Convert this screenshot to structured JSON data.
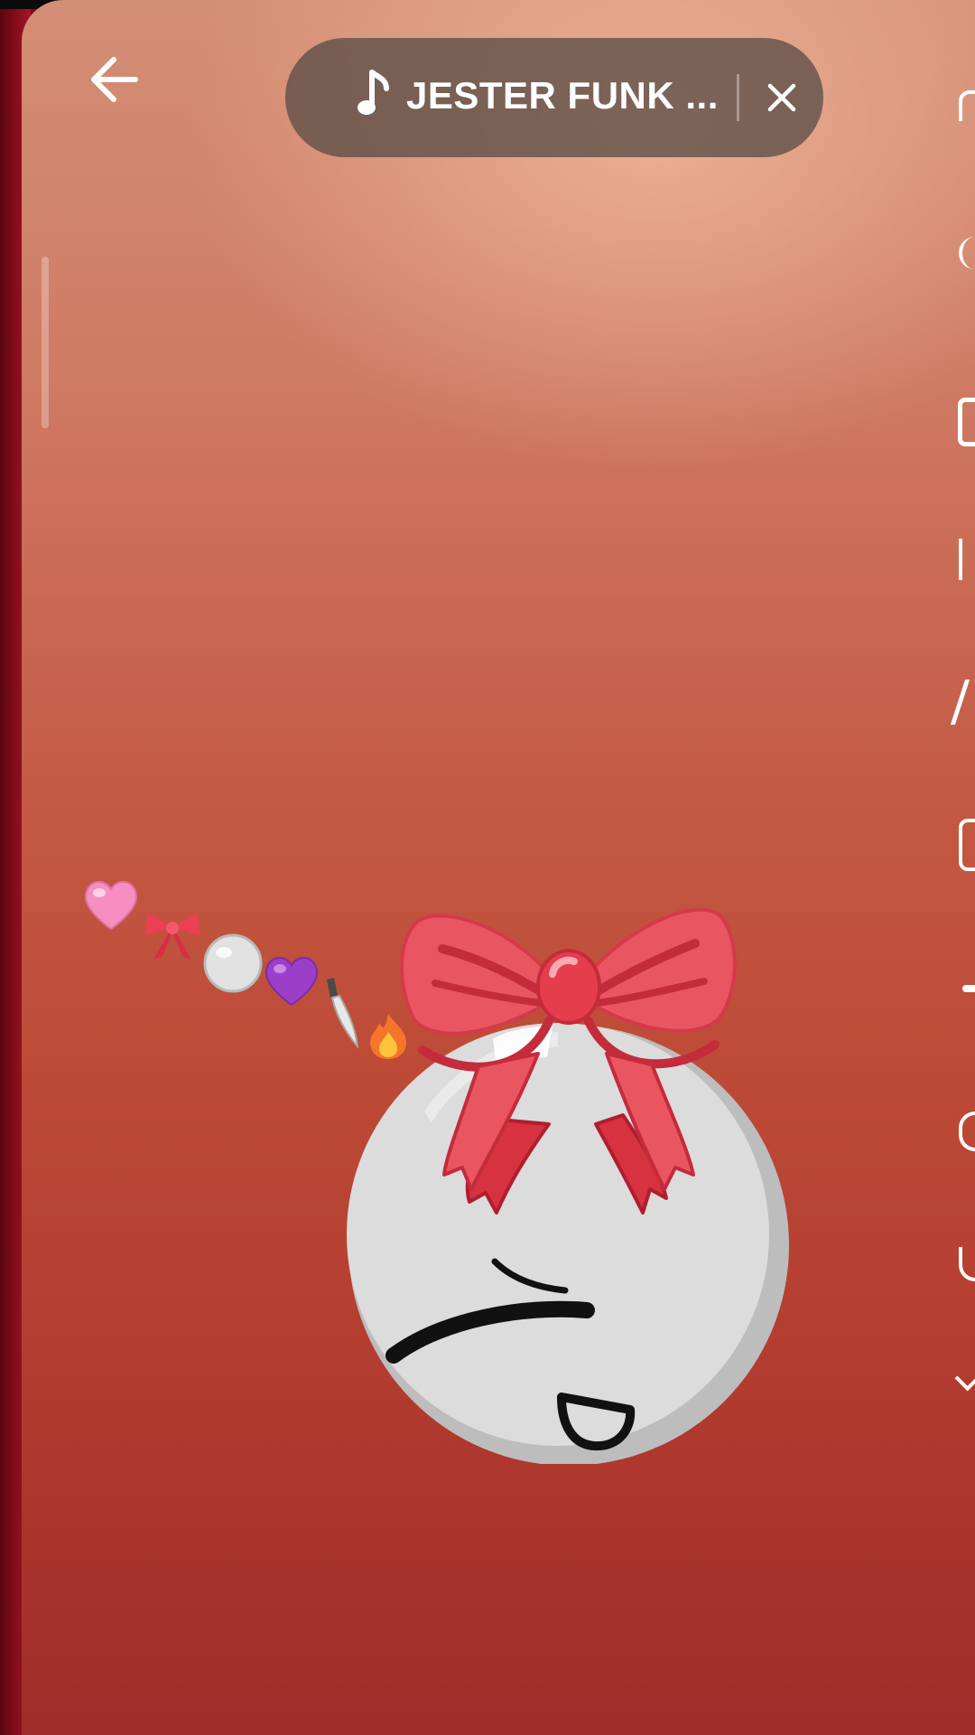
{
  "music": {
    "title": "JESTER FUNK ...",
    "note_icon": "music-note-icon",
    "close_icon": "close-icon"
  },
  "navigation": {
    "back_icon": "arrow-left-icon"
  },
  "emoji_trail": [
    "pink-heart-emoji",
    "ribbon-emoji",
    "white-circle-emoji",
    "purple-heart-emoji",
    "knife-emoji",
    "fire-emoji"
  ],
  "colors": {
    "pill_background": "#5c4e46",
    "bow_red": "#e8505e",
    "face_white": "#dcdcdc",
    "background_top": "#d38f76",
    "background_bottom": "#a02c29"
  }
}
